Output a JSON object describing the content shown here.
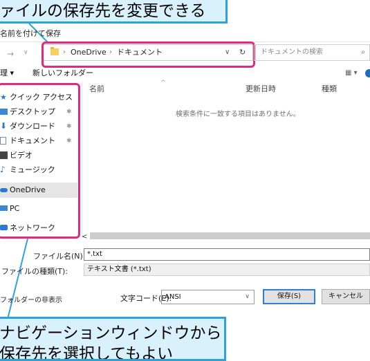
{
  "callouts": {
    "top_text": "ァイルの保存先を変更できる",
    "bottom_text": "ナビゲーションウィンドウから\n保存先を選択してもよい"
  },
  "dialog": {
    "title": "名前を付けて保存",
    "nav": {
      "back": "→",
      "forward": "→",
      "recent": "∨"
    }
  },
  "address_bar": {
    "crumbs": [
      "OneDrive",
      "ドキュメント"
    ],
    "separator": "›",
    "dropdown": "∨",
    "refresh": "↻"
  },
  "search": {
    "placeholder": "ドキュメントの検索",
    "icon": "search-icon"
  },
  "toolbar": {
    "organize": "理 ▾",
    "new_folder": "新しいフォルダー",
    "view": "▦ ▾"
  },
  "sidebar": {
    "items": [
      {
        "label": "クイック アクセス",
        "icon": "star-icon",
        "pinned": false
      },
      {
        "label": "デスクトップ",
        "icon": "desktop-icon",
        "pinned": true
      },
      {
        "label": "ダウンロード",
        "icon": "download-icon",
        "pinned": true
      },
      {
        "label": "ドキュメント",
        "icon": "document-icon",
        "pinned": true
      },
      {
        "label": "ビデオ",
        "icon": "video-icon",
        "pinned": false
      },
      {
        "label": "ミュージック",
        "icon": "music-icon",
        "pinned": false
      },
      {
        "label": "OneDrive",
        "icon": "cloud-icon",
        "pinned": false,
        "selected": true
      },
      {
        "label": "PC",
        "icon": "pc-icon",
        "pinned": false
      },
      {
        "label": "ネットワーク",
        "icon": "network-icon",
        "pinned": false
      }
    ],
    "pin_glyph": "📌"
  },
  "file_list": {
    "columns": [
      "名前",
      "更新日時",
      "種類"
    ],
    "sort_indicator": "^",
    "empty_message": "検索条件に一致する項目はありません。"
  },
  "scroll": {
    "left_arrow": "<"
  },
  "form": {
    "filename_label": "ファイル名(N):",
    "filename_value": "*.txt",
    "filetype_label": "ファイルの種類(T):",
    "filetype_value": "テキスト文書 (*.txt)"
  },
  "footer": {
    "hide_folders": "フォルダーの非表示",
    "encoding_label": "文字コード(E):",
    "encoding_value": "ANSI",
    "save": "保存(S)",
    "cancel": "キャンセル"
  },
  "colors": {
    "callout_bg": "#d9f1fc",
    "callout_border": "#2aa3da",
    "highlight": "#dd2c7c"
  }
}
